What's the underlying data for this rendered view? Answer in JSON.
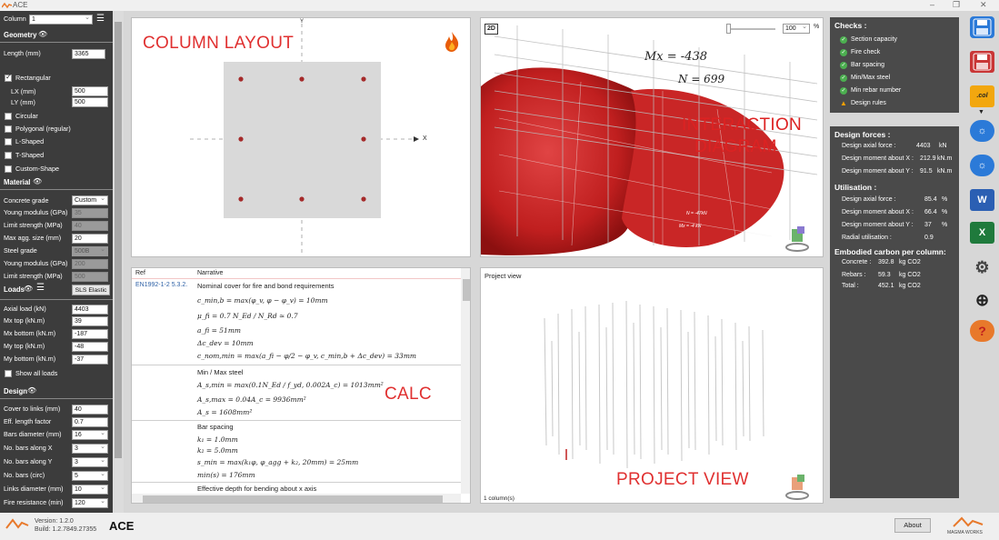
{
  "titlebar": {
    "title": "ACE",
    "minimize": "–",
    "restore": "❐",
    "close": "✕"
  },
  "left": {
    "column_label": "Column",
    "column_value": "1",
    "geometry": {
      "title": "Geometry",
      "length_label": "Length (mm)",
      "length": "3365",
      "rectangular": "Rectangular",
      "lx_label": "LX (mm)",
      "lx": "500",
      "ly_label": "LY (mm)",
      "ly": "500",
      "circular": "Circular",
      "polygonal": "Polygonal (regular)",
      "lshaped": "L-Shaped",
      "tshaped": "T-Shaped",
      "custom": "Custom-Shape"
    },
    "material": {
      "title": "Material",
      "concrete_grade_label": "Concrete grade",
      "concrete_grade": "Custom",
      "young_label": "Young modulus (GPa)",
      "young": "35",
      "limit_label": "Limit strength (MPa)",
      "limit": "40",
      "agg_label": "Max agg. size (mm)",
      "agg": "20",
      "steel_label": "Steel grade",
      "steel": "500B",
      "young2_label": "Young modulus (GPa)",
      "young2": "200",
      "limit2_label": "Limit strength (MPa)",
      "limit2": "500"
    },
    "loads": {
      "title": "Loads",
      "sls_button": "SLS Elastic",
      "axial_label": "Axial load (kN)",
      "axial": "4403",
      "mxtop_label": "Mx top (kN.m)",
      "mxtop": "39",
      "mxbot_label": "Mx bottom (kN.m)",
      "mxbot": "-187",
      "mytop_label": "My top (kN.m)",
      "mytop": "-48",
      "mybot_label": "My bottom (kN.m)",
      "mybot": "-37",
      "show_all": "Show all loads"
    },
    "design": {
      "title": "Design",
      "cover_label": "Cover to links (mm)",
      "cover": "40",
      "eff_label": "Eff. length factor",
      "eff": "0.7",
      "bars_dia_label": "Bars diameter (mm)",
      "bars_dia": "16",
      "nbx_label": "No. bars along X",
      "nbx": "3",
      "nby_label": "No. bars along Y",
      "nby": "3",
      "nbc_label": "No. bars (circ)",
      "nbc": "5",
      "links_label": "Links diameter (mm)",
      "links": "10",
      "fire_label": "Fire resistance (min)",
      "fire": "120"
    }
  },
  "layout": {
    "label": "COLUMN LAYOUT",
    "axis_x": "X",
    "axis_y": "Y"
  },
  "interaction": {
    "label_line1": "INTERACTION",
    "label_line2": "DIAGRAM",
    "toggle_2d": "2D",
    "zoom": "100",
    "zoom_unit": "%",
    "mx": "Mx = -438",
    "n": "N = 699",
    "mx_small": "Mx = -4 kN",
    "n_small": "N = -47kN"
  },
  "calc": {
    "label": "CALC",
    "col_ref": "Ref",
    "col_narrative": "Narrative",
    "ref1": "EN1992-1-2 5.3.2.",
    "sec1_title": "Nominal cover for fire and bond requirements",
    "sec1_l1": "c_min,b = max(φ_v, φ − φ_v) = 10mm",
    "sec1_l2": "μ_fi = 0.7 N_Ed / N_Rd ≃ 0.7",
    "sec1_l3": "a_fi = 51mm",
    "sec1_l4": "Δc_dev = 10mm",
    "sec1_l5": "c_nom,min = max(a_fi − φ/2 − φ_v, c_min,b + Δc_dev) = 33mm",
    "sec2_title": "Min / Max steel",
    "sec2_l1": "A_s,min = max(0.1N_Ed / f_yd, 0.002A_c) = 1013mm²",
    "sec2_l2": "A_s,max = 0.04A_c = 9936mm²",
    "sec2_l3": "A_s = 1608mm²",
    "sec3_title": "Bar spacing",
    "sec3_l1": "k₁ = 1.0mm",
    "sec3_l2": "k₂ = 5.0mm",
    "sec3_l3": "s_min = max(k₁φ, φ_agg + k₂, 20mm) = 25mm",
    "sec3_l4": "min(s) = 176mm",
    "sec4_title": "Effective depth for bending about x axis"
  },
  "project": {
    "title": "Project view",
    "label": "PROJECT VIEW",
    "count": "1 column(s)"
  },
  "checks": {
    "title": "Checks :",
    "items": [
      "Section capacity",
      "Fire check",
      "Bar spacing",
      "Min/Max steel",
      "Min rebar number"
    ],
    "warning": "Design rules"
  },
  "forces": {
    "title": "Design forces :",
    "axial_label": "Design axial force :",
    "axial": "4403",
    "axial_unit": "kN",
    "mx_label": "Design moment about X :",
    "mx": "212.9",
    "mx_unit": "kN.m",
    "my_label": "Design moment about Y :",
    "my": "91.5",
    "my_unit": "kN.m",
    "util_title": "Utilisation :",
    "u_axial_label": "Design axial force :",
    "u_axial": "85.4",
    "u_axial_unit": "%",
    "u_mx_label": "Design moment about X :",
    "u_mx": "66.4",
    "u_mx_unit": "%",
    "u_my_label": "Design moment about Y :",
    "u_my": "37",
    "u_my_unit": "%",
    "radial_label": "Radial utilisation :",
    "radial": "0.9",
    "carbon_title": "Embodied carbon per column:",
    "concrete_label": "Concrete :",
    "concrete": "392.8",
    "concrete_unit": "kg CO2",
    "rebars_label": "Rebars :",
    "rebars": "59.3",
    "rebars_unit": "kg CO2",
    "total_label": "Total :",
    "total": "452.1",
    "total_unit": "kg CO2"
  },
  "toolbar": {
    "col_icon_text": ".col",
    "word": "W",
    "excel": "X",
    "help": "?"
  },
  "footer": {
    "version": "Version: 1.2.0",
    "build": "Build: 1.2.7849.27355",
    "app": "ACE",
    "about": "About",
    "brand": "MAGMA WORKS"
  },
  "colors": {
    "accent_red": "#e03030",
    "dark_panel": "#4a4a4a",
    "left_panel": "#3c3c3c",
    "ok_green": "#4caf50"
  }
}
